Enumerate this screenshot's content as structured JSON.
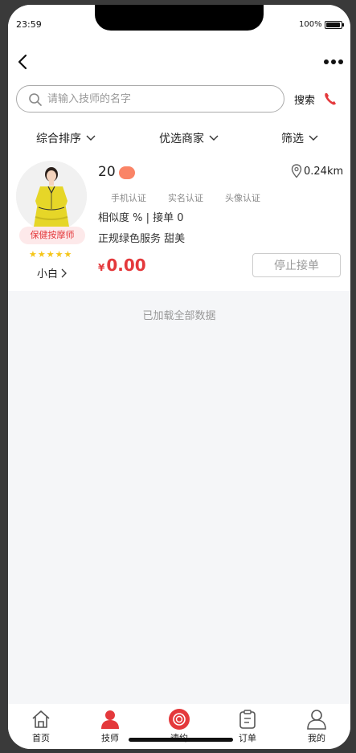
{
  "status_bar": {
    "time": "23:59",
    "battery_text": "100%",
    "battery_level": 1.0
  },
  "search": {
    "placeholder": "请输入技师的名字",
    "value": "",
    "button_label": "搜索"
  },
  "filters": {
    "sort": "综合排序",
    "merchant": "优选商家",
    "filter": "筛选"
  },
  "technician": {
    "age": "20",
    "distance": "0.24km",
    "certs": [
      "手机认证",
      "实名认证",
      "头像认证"
    ],
    "stats": "相似度 % | 接单 0",
    "description": "正规绿色服务 甜美",
    "price_currency": "¥",
    "price": "0.00",
    "role": "保健按摩师",
    "rating": 5,
    "stars": "★★★★★",
    "name": "小白",
    "stop_button": "停止接单"
  },
  "loaded_text": "已加载全部数据",
  "tabs": {
    "home": "首页",
    "technician": "技师",
    "call": "速约",
    "orders": "订单",
    "mine": "我的"
  },
  "colors": {
    "accent": "#e4393c",
    "gender_badge": "#fa8466",
    "star": "#f5c518",
    "background": "#f5f6f8"
  }
}
